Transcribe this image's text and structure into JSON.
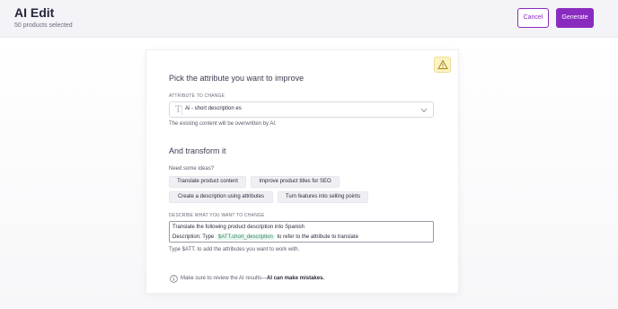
{
  "header": {
    "title": "AI Edit",
    "subtitle": "50 products selected",
    "cancel_label": "Cancel",
    "generate_label": "Generate"
  },
  "attribute_section": {
    "heading": "Pick the attribute you want to improve",
    "field_caption": "ATTRIBUTE TO CHANGE",
    "selected_value": "Ai - short description es",
    "helper": "The existing content will be overwritten by AI."
  },
  "transform_section": {
    "heading": "And transform it",
    "ideas_label": "Need some ideas?",
    "suggestions": [
      "Translate product content",
      "Improve product titles for SEO",
      "Create a description using attributes",
      "Turn features into selling points"
    ],
    "field_caption": "DESCRIBE WHAT YOU WANT TO CHANGE",
    "prompt_line1": "Translate the following product description into Spanish",
    "prompt_line2_prefix": "Description: Type",
    "prompt_attribute_tag": "$ATT.short_description",
    "prompt_line2_suffix": "to refer to the attribute to translate",
    "helper": "Type $ATT. to add the attributes you want to work with."
  },
  "disclaimer": {
    "text": "Make sure to review the AI results—",
    "emphasis": "AI can make mistakes."
  },
  "colors": {
    "accent": "#8a2bc0",
    "header_bg": "#f4f3f8",
    "warning_bg": "#fbf2c6",
    "tag_bg": "#e6f6ef"
  },
  "icons": [
    "warning-icon",
    "text-type-icon",
    "chevron-down-icon",
    "info-icon"
  ]
}
